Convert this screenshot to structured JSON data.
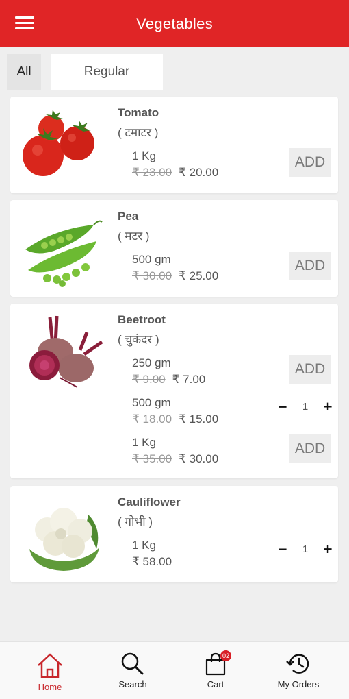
{
  "appbar": {
    "title": "Vegetables"
  },
  "tabs": [
    {
      "label": "All"
    },
    {
      "label": "Regular"
    }
  ],
  "products": [
    {
      "name": "Tomato",
      "local_name": "( टमाटर )",
      "variants": [
        {
          "qty": "1 Kg",
          "mrp": "₹ 23.00",
          "price": "₹ 20.00",
          "action": "ADD"
        }
      ]
    },
    {
      "name": "Pea",
      "local_name": "( मटर )",
      "variants": [
        {
          "qty": "500 gm",
          "mrp": "₹ 30.00",
          "price": "₹ 25.00",
          "action": "ADD"
        }
      ]
    },
    {
      "name": "Beetroot",
      "local_name": "( चुकंदर )",
      "variants": [
        {
          "qty": "250 gm",
          "mrp": "₹ 9.00",
          "price": "₹ 7.00",
          "action": "ADD"
        },
        {
          "qty": "500 gm",
          "mrp": "₹ 18.00",
          "price": "₹ 15.00",
          "count": "1",
          "minus": "−",
          "plus": "+"
        },
        {
          "qty": "1 Kg",
          "mrp": "₹ 35.00",
          "price": "₹ 30.00",
          "action": "ADD"
        }
      ]
    },
    {
      "name": "Cauliflower",
      "local_name": "( गोभी )",
      "variants": [
        {
          "qty": "1 Kg",
          "price": "₹ 58.00",
          "count": "1",
          "minus": "−",
          "plus": "+"
        }
      ]
    }
  ],
  "bottom_nav": [
    {
      "label": "Home",
      "icon": "home-icon",
      "active": true
    },
    {
      "label": "Search",
      "icon": "search-icon"
    },
    {
      "label": "Cart",
      "icon": "cart-bag-icon",
      "badge": "02"
    },
    {
      "label": "My Orders",
      "icon": "history-icon"
    }
  ],
  "colors": {
    "brand": "#e02526",
    "active_nav": "#c8262b",
    "badge": "#d81f26"
  }
}
